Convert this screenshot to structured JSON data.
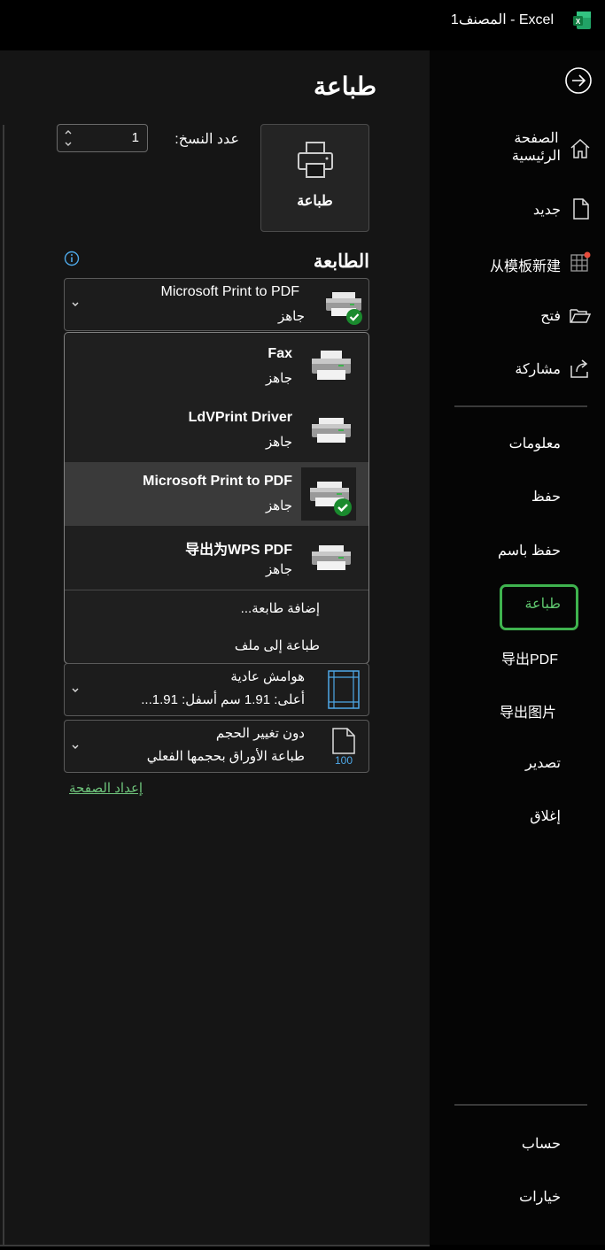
{
  "titlebar": {
    "title": "المصنف1  -  Excel"
  },
  "sidebar": {
    "items": [
      {
        "label": "الصفحة الرئيسية",
        "icon": "home-icon"
      },
      {
        "label": "جديد",
        "icon": "new-document-icon"
      },
      {
        "label": "从模板新建",
        "icon": "template-icon"
      },
      {
        "label": "فتح",
        "icon": "folder-open-icon"
      },
      {
        "label": "مشاركة",
        "icon": "share-icon"
      },
      {
        "label": "معلومات"
      },
      {
        "label": "حفظ"
      },
      {
        "label": "حفظ باسم"
      },
      {
        "label": "طباعة",
        "active": true
      },
      {
        "label": "导出PDF"
      },
      {
        "label": "导出图片"
      },
      {
        "label": "تصدير"
      },
      {
        "label": "إغلاق"
      },
      {
        "label": "حساب"
      },
      {
        "label": "خيارات"
      }
    ],
    "home_line1": "الصفحة",
    "home_line2": "الرئيسية",
    "active_color": "#3fb34f"
  },
  "main": {
    "title": "طباعة",
    "print_button_label": "طباعة",
    "copies_label": "عدد النسخ:",
    "copies_value": "1",
    "printer_heading": "الطابعة",
    "selected_printer": {
      "name": "Microsoft Print to PDF",
      "status": "جاهز"
    },
    "printers": [
      {
        "name": "Fax",
        "status": "جاهز"
      },
      {
        "name": "LdVPrint Driver",
        "status": "جاهز"
      },
      {
        "name": "Microsoft Print to PDF",
        "status": "جاهز",
        "selected": true
      },
      {
        "name": "导出为WPS PDF",
        "status": "جاهز"
      }
    ],
    "add_printer": "إضافة طابعة...",
    "print_to_file": "طباعة إلى ملف",
    "margins": {
      "line1": "هوامش عادية",
      "line2": "أعلى: 1.91 سم أسفل: 1.91..."
    },
    "scaling": {
      "line1": "دون تغيير الحجم",
      "line2": "طباعة الأوراق بحجمها الفعلي",
      "icon_text": "100"
    },
    "page_setup": "إعداد الصفحة"
  }
}
